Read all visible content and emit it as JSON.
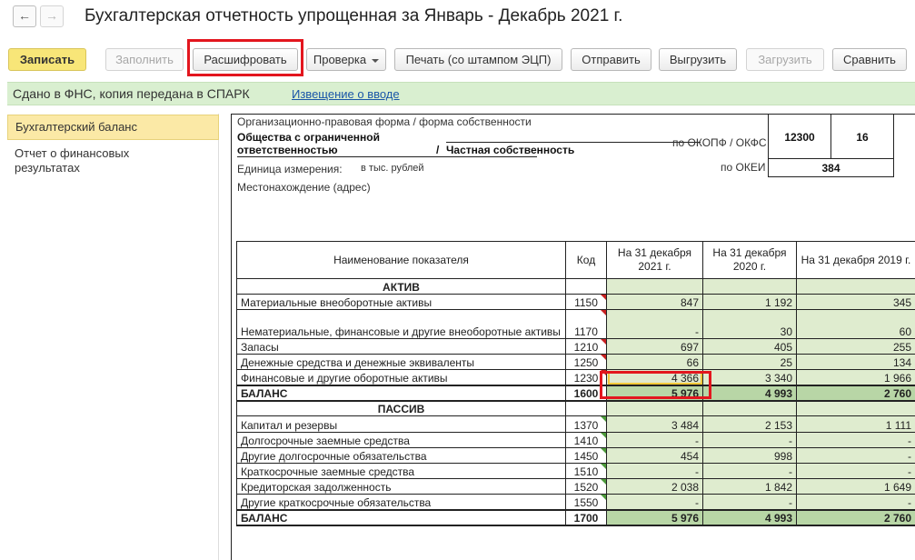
{
  "window": {
    "title": "Бухгалтерская отчетность упрощенная за Январь - Декабрь 2021 г.",
    "back_glyph": "←",
    "forward_glyph": "→"
  },
  "toolbar": {
    "save": "Записать",
    "fill": "Заполнить",
    "decode": "Расшифровать",
    "check": "Проверка",
    "print": "Печать (со штампом ЭЦП)",
    "send": "Отправить",
    "export": "Выгрузить",
    "import": "Загрузить",
    "compare": "Сравнить"
  },
  "status": {
    "text": "Сдано в ФНС, копия передана в СПАРК",
    "link": "Извещение о вводе"
  },
  "sidebar": {
    "items": [
      {
        "label": "Бухгалтерский баланс"
      },
      {
        "label": "Отчет о финансовых результатах"
      }
    ]
  },
  "header": {
    "org_form_label": "Организационно-правовая форма / форма собственности",
    "org_form_line1": "Общества с ограниченной",
    "org_form_line2": "ответственностью",
    "slash": "/",
    "ownership": "Частная собственность",
    "okopf_label": "по ОКОПФ / ОКФС",
    "okopf_code": "12300",
    "okfs_code": "16",
    "okei_label": "по ОКЕИ",
    "okei_code": "384",
    "unit_label": "Единица измерения:",
    "unit_value": "в тыс. рублей",
    "location_label": "Местонахождение (адрес)"
  },
  "table": {
    "headers": [
      "Наименование показателя",
      "Код",
      "На 31 декабря 2021 г.",
      "На 31 декабря 2020 г.",
      "На 31 декабря 2019 г."
    ],
    "section_assets": "АКТИВ",
    "section_liabilities": "ПАССИВ",
    "rows_assets": [
      {
        "name": "Материальные внеоборотные активы",
        "code": "1150",
        "v2021": "847",
        "v2020": "1 192",
        "v2019": "345"
      },
      {
        "name": "Нематериальные, финансовые и другие внеоборотные активы",
        "code": "1170",
        "v2021": "-",
        "v2020": "30",
        "v2019": "60"
      },
      {
        "name": "Запасы",
        "code": "1210",
        "v2021": "697",
        "v2020": "405",
        "v2019": "255"
      },
      {
        "name": "Денежные средства и денежные эквиваленты",
        "code": "1250",
        "v2021": "66",
        "v2020": "25",
        "v2019": "134"
      },
      {
        "name": "Финансовые и другие оборотные активы",
        "code": "1230",
        "v2021": "4 366",
        "v2020": "3 340",
        "v2019": "1 966"
      }
    ],
    "total_assets": {
      "name": "БАЛАНС",
      "code": "1600",
      "v2021": "5 976",
      "v2020": "4 993",
      "v2019": "2 760"
    },
    "rows_liabilities": [
      {
        "name": "Капитал и резервы",
        "code": "1370",
        "v2021": "3 484",
        "v2020": "2 153",
        "v2019": "1 111"
      },
      {
        "name": "Долгосрочные заемные средства",
        "code": "1410",
        "v2021": "-",
        "v2020": "-",
        "v2019": "-"
      },
      {
        "name": "Другие долгосрочные обязательства",
        "code": "1450",
        "v2021": "454",
        "v2020": "998",
        "v2019": "-"
      },
      {
        "name": "Краткосрочные заемные средства",
        "code": "1510",
        "v2021": "-",
        "v2020": "-",
        "v2019": "-"
      },
      {
        "name": "Кредиторская задолженность",
        "code": "1520",
        "v2021": "2 038",
        "v2020": "1 842",
        "v2019": "1 649"
      },
      {
        "name": "Другие краткосрочные обязательства",
        "code": "1550",
        "v2021": "-",
        "v2020": "-",
        "v2019": "-"
      }
    ],
    "total_liabilities": {
      "name": "БАЛАНС",
      "code": "1700",
      "v2021": "5 976",
      "v2020": "4 993",
      "v2019": "2 760"
    }
  },
  "colors": {
    "primary_button": "#f8e678",
    "highlight_box": "#e3161e",
    "status_bg": "#d9efd0",
    "value_cell": "#dfeccf",
    "total_cell": "#b8d6a6"
  }
}
